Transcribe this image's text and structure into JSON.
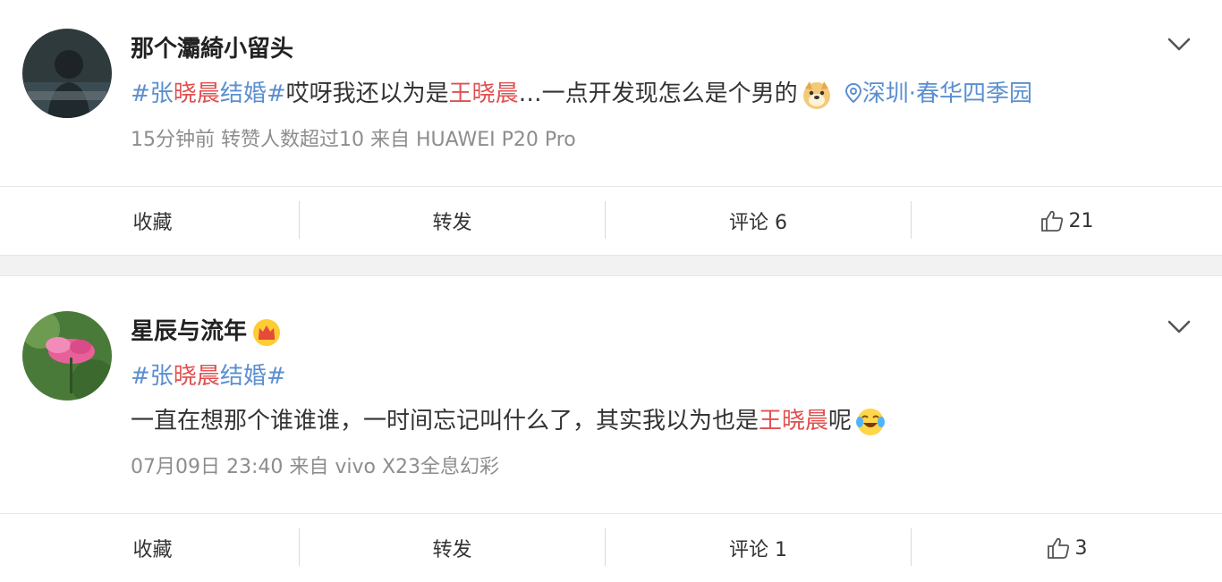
{
  "posts": [
    {
      "username": "那个灞綺小留头",
      "content": {
        "topic_hash1": "#",
        "topic_a": "张",
        "topic_b": "晓晨",
        "topic_c": "结婚",
        "topic_hash2": "#",
        "text1": "哎呀我还以为是",
        "name": "王晓晨",
        "text2": "…一点开发现怎么是个男的",
        "emoji": "doge-emoji",
        "location": "深圳·春华四季园"
      },
      "meta": "15分钟前  转赞人数超过10  来自 HUAWEI P20 Pro",
      "actions": {
        "collect": "收藏",
        "repost": "转发",
        "comment": "评论 6",
        "like": "21"
      }
    },
    {
      "username": "星辰与流年",
      "badge": "crown-icon",
      "content": {
        "topic_hash1": "#",
        "topic_a": "张",
        "topic_b": "晓晨",
        "topic_c": "结婚",
        "topic_hash2": "#",
        "text1": "一直在想那个谁谁谁，一时间忘记叫什么了，其实我以为也是",
        "name": "王晓晨",
        "text2": "呢",
        "emoji": "laugh-cry-emoji"
      },
      "meta": "07月09日 23:40  来自 vivo X23全息幻彩",
      "actions": {
        "collect": "收藏",
        "repost": "转发",
        "comment": "评论 1",
        "like": "3"
      }
    }
  ],
  "colors": {
    "topic": "#5b8fd0",
    "highlight": "#e05050",
    "meta": "#8d8d8d"
  }
}
